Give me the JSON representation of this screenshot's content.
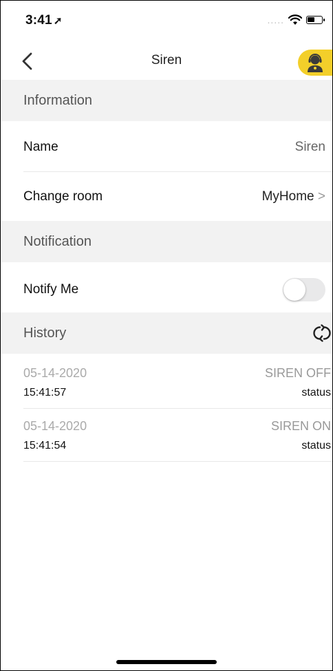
{
  "status_bar": {
    "time": "3:41",
    "dots": "....."
  },
  "nav": {
    "title": "Siren"
  },
  "sections": {
    "information": "Information",
    "notification": "Notification",
    "history": "History"
  },
  "info": {
    "name_label": "Name",
    "name_value": "Siren",
    "room_label": "Change room",
    "room_value": "MyHome",
    "chevron": ">"
  },
  "notify": {
    "label": "Notify Me",
    "enabled": false
  },
  "history": [
    {
      "date": "05-14-2020",
      "time": "15:41:57",
      "event": "SIREN OFF",
      "status": "status"
    },
    {
      "date": "05-14-2020",
      "time": "15:41:54",
      "event": "SIREN ON",
      "status": "status"
    }
  ],
  "colors": {
    "accent_yellow": "#f3cf2a",
    "section_bg": "#f2f2f2"
  }
}
